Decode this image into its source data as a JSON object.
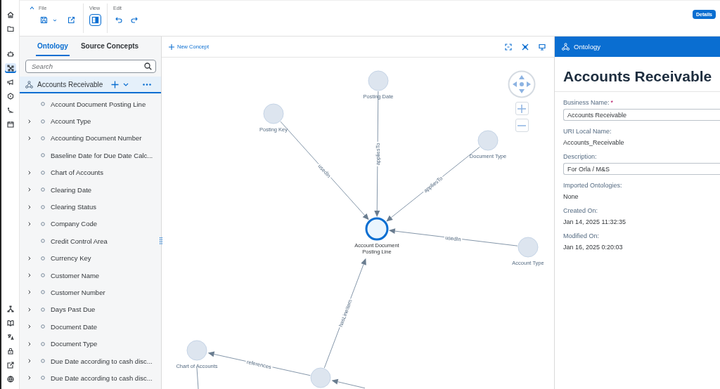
{
  "rail": {
    "top": [
      {
        "selected": false
      },
      {
        "selected": false
      },
      {
        "selected": false
      },
      {
        "selected": true
      },
      {
        "selected": false
      },
      {
        "selected": false
      },
      {
        "selected": false
      },
      {
        "selected": false
      }
    ],
    "bottom": [
      {
        "selected": false
      },
      {
        "selected": false
      },
      {
        "selected": false
      },
      {
        "selected": false
      },
      {
        "selected": false
      },
      {
        "selected": false
      }
    ]
  },
  "toolbar": {
    "groups": [
      {
        "label": "File",
        "buttons": [
          {
            "pressed": false
          },
          {
            "pressed": false
          }
        ]
      },
      {
        "label": "View",
        "buttons": [
          {
            "pressed": true
          }
        ]
      },
      {
        "label": "Edit",
        "buttons": [
          {
            "pressed": false
          },
          {
            "pressed": false
          }
        ]
      }
    ],
    "details_button": "Details"
  },
  "left_panel": {
    "tabs": [
      {
        "label": "Ontology",
        "selected": true
      },
      {
        "label": "Source Concepts",
        "selected": false
      }
    ],
    "search": {
      "placeholder": "Search"
    },
    "root": {
      "label": "Accounts Receivable",
      "selected": true
    },
    "items": [
      {
        "label": "Account Document Posting Line",
        "expandable": false
      },
      {
        "label": "Account Type",
        "expandable": true
      },
      {
        "label": "Accounting Document Number",
        "expandable": true
      },
      {
        "label": "Baseline Date for Due Date Calc...",
        "expandable": false
      },
      {
        "label": "Chart of Accounts",
        "expandable": true
      },
      {
        "label": "Clearing Date",
        "expandable": true
      },
      {
        "label": "Clearing Status",
        "expandable": true
      },
      {
        "label": "Company Code",
        "expandable": true
      },
      {
        "label": "Credit Control Area",
        "expandable": false
      },
      {
        "label": "Currency Key",
        "expandable": true
      },
      {
        "label": "Customer Name",
        "expandable": true
      },
      {
        "label": "Customer Number",
        "expandable": true
      },
      {
        "label": "Days Past Due",
        "expandable": true
      },
      {
        "label": "Document Date",
        "expandable": true
      },
      {
        "label": "Document Type",
        "expandable": true
      },
      {
        "label": "Due Date according to cash disc...",
        "expandable": true
      },
      {
        "label": "Due Date according to cash disc...",
        "expandable": true
      }
    ]
  },
  "canvas": {
    "new_button": "New Concept",
    "nodes": [
      {
        "label": "Posting Date",
        "selected": false
      },
      {
        "label": "Posting Key",
        "selected": false
      },
      {
        "label": "Document Type",
        "selected": false
      },
      {
        "label": "Account Document Posting Line",
        "selected": true
      },
      {
        "label": "Account Type",
        "selected": false
      },
      {
        "label": "Chart of Accounts",
        "selected": false
      },
      {
        "selected": false
      }
    ],
    "edges": [
      {
        "label": "usedIn"
      },
      {
        "label": "appliesTo"
      },
      {
        "label": "appliesTo"
      },
      {
        "label": "usedIn"
      },
      {
        "label": "hasLineItem"
      },
      {
        "label": "references"
      }
    ]
  },
  "details": {
    "header": "Ontology",
    "title": "Accounts Receivable",
    "fields": [
      {
        "label": "Business Name:",
        "kind": "input",
        "required_mark": "*",
        "value": "Accounts Receivable"
      },
      {
        "label": "URI Local Name:",
        "kind": "text",
        "value": "Accounts_Receivable"
      },
      {
        "label": "Description:",
        "kind": "input",
        "value": "For Orla / M&S"
      },
      {
        "label": "Imported Ontologies:",
        "kind": "text",
        "value": "None"
      },
      {
        "label": "Created On:",
        "kind": "text",
        "value": "Jan 14, 2025 11:32:35"
      },
      {
        "label": "Modified On:",
        "kind": "text",
        "value": "Jan 16, 2025 0:20:03"
      }
    ]
  }
}
